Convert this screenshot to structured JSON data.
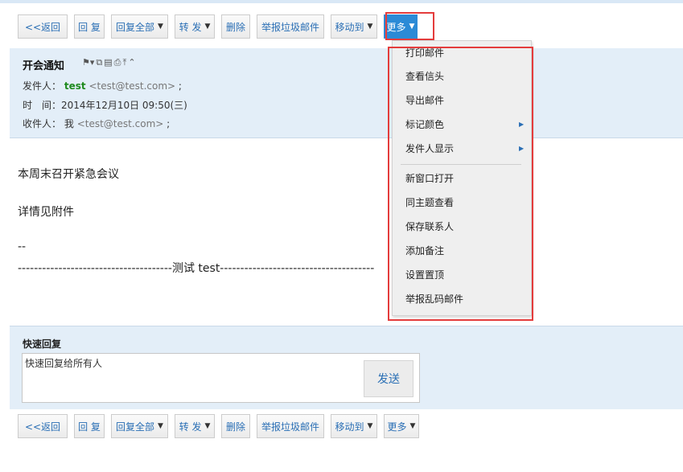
{
  "toolbar": {
    "back": "<<返回",
    "reply": "回 复",
    "reply_all": "回复全部",
    "forward": "转 发",
    "delete": "删除",
    "report_spam": "举报垃圾邮件",
    "move_to": "移动到",
    "more": "更多"
  },
  "mail": {
    "subject": "开会通知",
    "from_label": "发件人：",
    "from_name": "test",
    "from_email": "<test@test.com>",
    "from_sep": ";",
    "time_label": "时　间：",
    "time_value": "2014年12月10日 09:50(三)",
    "to_label": "收件人：",
    "to_name": "我",
    "to_email": "<test@test.com>",
    "to_sep": ";",
    "body": {
      "line1": "本周末召开紧急会议",
      "line2": "详情见附件",
      "line3": "--",
      "line4": "--------------------------------------测试 test--------------------------------------"
    }
  },
  "more_menu": {
    "items": [
      "打印邮件",
      "查看信头",
      "导出邮件",
      "标记颜色",
      "发件人显示",
      "新窗口打开",
      "同主题查看",
      "保存联系人",
      "添加备注",
      "设置置顶",
      "举报乱码邮件"
    ]
  },
  "quick_reply": {
    "title": "快速回复",
    "placeholder": "快速回复给所有人",
    "send": "发送"
  },
  "colors": {
    "accent": "#2b8ad6",
    "header_bg": "#e3eef8",
    "highlight_border": "#e43c3c",
    "link": "#2a6fb5"
  }
}
